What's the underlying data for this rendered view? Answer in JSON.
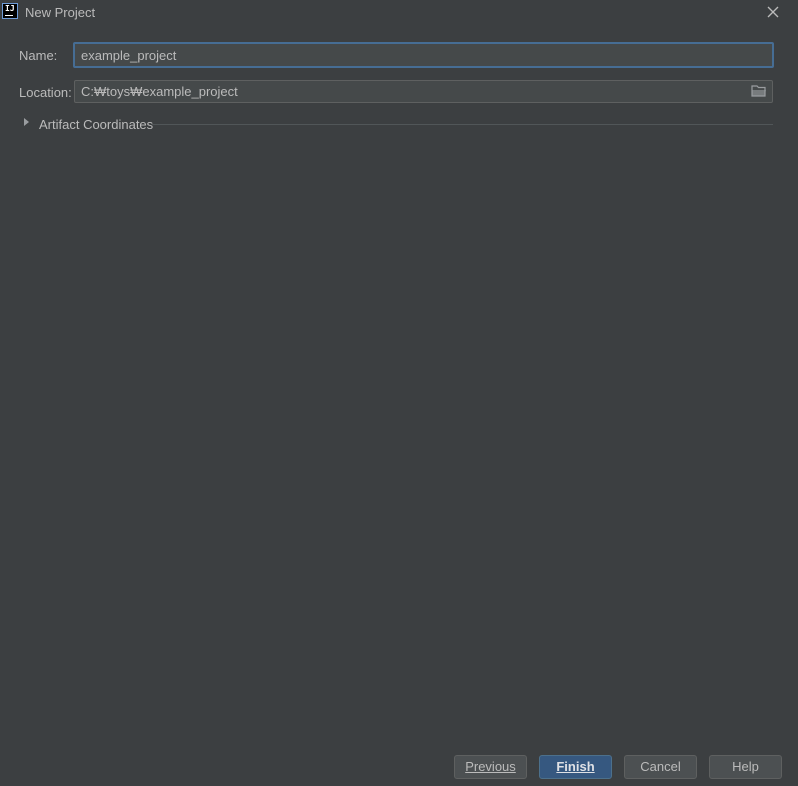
{
  "window": {
    "title": "New Project",
    "app_icon_text": "IJ"
  },
  "form": {
    "name_label": "Name:",
    "name_value": "example_project",
    "location_label": "Location:",
    "location_value": "C:₩toys₩example_project"
  },
  "artifact": {
    "label": "Artifact Coordinates",
    "expanded": false
  },
  "buttons": {
    "previous": "Previous",
    "finish": "Finish",
    "cancel": "Cancel",
    "help": "Help"
  },
  "colors": {
    "background": "#3c3f41",
    "input_bg": "#45494a",
    "focus_border": "#466d94",
    "primary_button": "#365880",
    "text": "#bbbbbb"
  }
}
